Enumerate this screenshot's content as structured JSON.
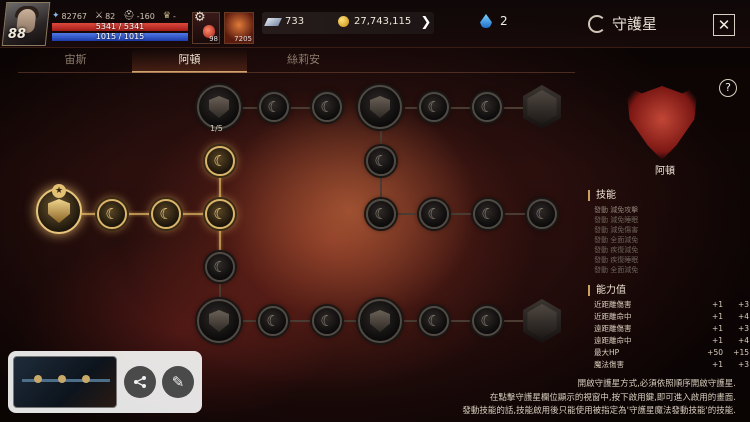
{
  "player": {
    "level": "88",
    "power": "82767",
    "attack": "82",
    "defense_range": "-160",
    "trophy": "-",
    "hp": "5341 / 5341",
    "mp": "1015 / 1015",
    "hp_fraction": 1.0,
    "mp_fraction": 1.0
  },
  "slots": {
    "potion_count": "98",
    "item_count": "7205"
  },
  "currency": {
    "crystals": "733",
    "gold": "27,743,115"
  },
  "gems": "2",
  "header": {
    "title": "守護星"
  },
  "tabs": [
    "宙斯",
    "阿頓",
    "絲莉安"
  ],
  "map": {
    "node_progress": "1/5"
  },
  "panel": {
    "constellation_name": "阿頓",
    "skills_title": "技能",
    "skills": [
      "發動 減免攻擊",
      "發動 減免睡眠",
      "發動 減免傷害",
      "發動 全面減免",
      "發動 疾復減免",
      "發動 疾復睡眠",
      "發動 全面減免"
    ],
    "abilities_title": "能力值",
    "abilities": [
      {
        "name": "近距離傷害",
        "a": "+1",
        "b": "+3"
      },
      {
        "name": "近距離命中",
        "a": "+1",
        "b": "+4"
      },
      {
        "name": "遠距離傷害",
        "a": "+1",
        "b": "+3"
      },
      {
        "name": "遠距離命中",
        "a": "+1",
        "b": "+4"
      },
      {
        "name": "最大HP",
        "a": "+50",
        "b": "+15"
      },
      {
        "name": "魔法傷害",
        "a": "+1",
        "b": "+3"
      }
    ]
  },
  "info": {
    "line1": "開啟守護星方式,必須依照順序開啟守護星.",
    "line2": "在點擊守護星欄位顯示的視窗中,按下啟用鍵,即可進入啟用的畫面.",
    "line3": "發動技能的話,技能啟用後只能使用被指定為'守護星魔法發動技能'的技能."
  },
  "colors": {
    "accent": "#d9b46a",
    "hp": "#c0261f",
    "mp": "#2f56d0"
  }
}
